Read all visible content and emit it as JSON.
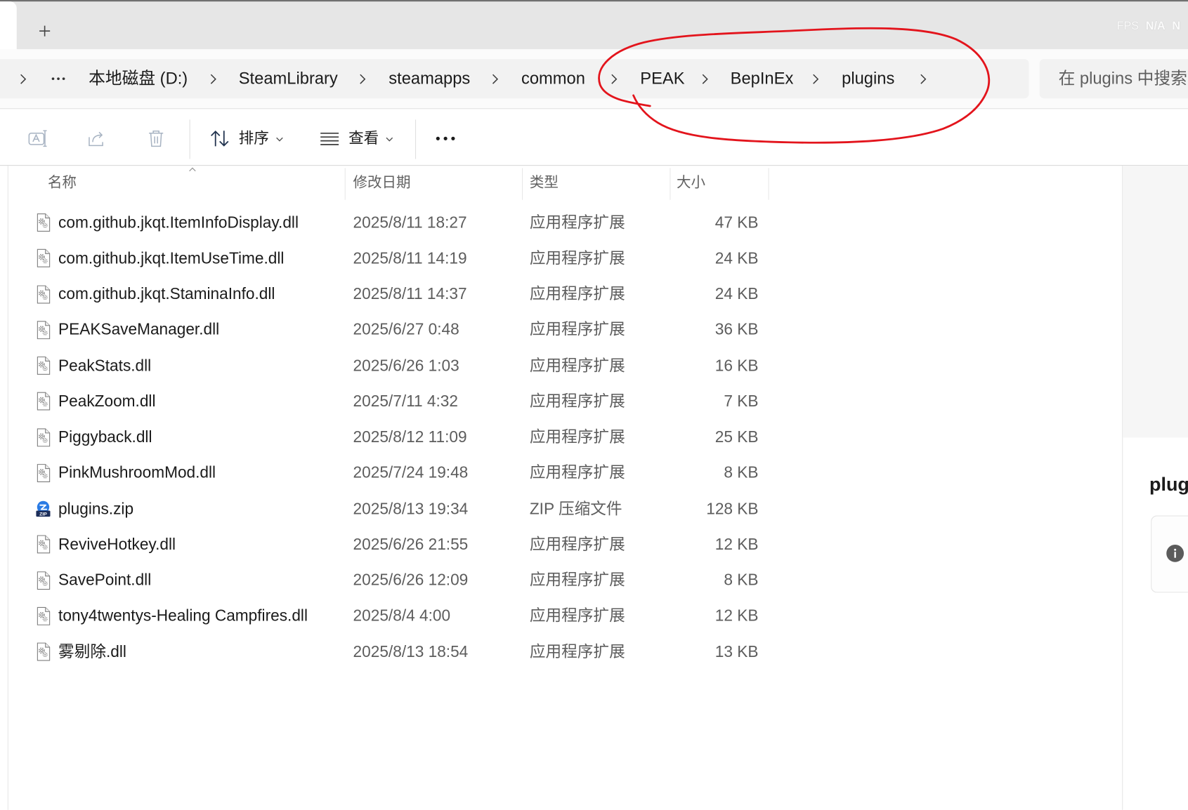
{
  "overlay": {
    "fps_label": "FPS",
    "fps_value": "N/A",
    "fps_extra": "N"
  },
  "breadcrumb": {
    "items": [
      {
        "label": "本地磁盘 (D:)"
      },
      {
        "label": "SteamLibrary"
      },
      {
        "label": "steamapps"
      },
      {
        "label": "common"
      },
      {
        "label": "PEAK"
      },
      {
        "label": "BepInEx"
      },
      {
        "label": "plugins"
      }
    ]
  },
  "search": {
    "placeholder": "在 plugins 中搜索"
  },
  "toolbar": {
    "icons": [
      "rename-icon",
      "share-icon",
      "delete-icon",
      "sort-icon",
      "view-icon",
      "more-icon"
    ],
    "sort_label": "排序",
    "view_label": "查看"
  },
  "columns": {
    "name": "名称",
    "modified": "修改日期",
    "type": "类型",
    "size": "大小",
    "sort_indicator_icon": "chevron-up-icon"
  },
  "files": [
    {
      "name": "com.github.jkqt.ItemInfoDisplay.dll",
      "modified": "2025/8/11 18:27",
      "type": "应用程序扩展",
      "size": "47 KB",
      "icon": "dll-file-icon"
    },
    {
      "name": "com.github.jkqt.ItemUseTime.dll",
      "modified": "2025/8/11 14:19",
      "type": "应用程序扩展",
      "size": "24 KB",
      "icon": "dll-file-icon"
    },
    {
      "name": "com.github.jkqt.StaminaInfo.dll",
      "modified": "2025/8/11 14:37",
      "type": "应用程序扩展",
      "size": "24 KB",
      "icon": "dll-file-icon"
    },
    {
      "name": "PEAKSaveManager.dll",
      "modified": "2025/6/27 0:48",
      "type": "应用程序扩展",
      "size": "36 KB",
      "icon": "dll-file-icon"
    },
    {
      "name": "PeakStats.dll",
      "modified": "2025/6/26 1:03",
      "type": "应用程序扩展",
      "size": "16 KB",
      "icon": "dll-file-icon"
    },
    {
      "name": "PeakZoom.dll",
      "modified": "2025/7/11 4:32",
      "type": "应用程序扩展",
      "size": "7 KB",
      "icon": "dll-file-icon"
    },
    {
      "name": "Piggyback.dll",
      "modified": "2025/8/12 11:09",
      "type": "应用程序扩展",
      "size": "25 KB",
      "icon": "dll-file-icon"
    },
    {
      "name": "PinkMushroomMod.dll",
      "modified": "2025/7/24 19:48",
      "type": "应用程序扩展",
      "size": "8 KB",
      "icon": "dll-file-icon"
    },
    {
      "name": "plugins.zip",
      "modified": "2025/8/13 19:34",
      "type": "ZIP 压缩文件",
      "size": "128 KB",
      "icon": "zip-file-icon",
      "icon_text": "ZIP"
    },
    {
      "name": "ReviveHotkey.dll",
      "modified": "2025/6/26 21:55",
      "type": "应用程序扩展",
      "size": "12 KB",
      "icon": "dll-file-icon"
    },
    {
      "name": "SavePoint.dll",
      "modified": "2025/6/26 12:09",
      "type": "应用程序扩展",
      "size": "8 KB",
      "icon": "dll-file-icon"
    },
    {
      "name": "tony4twentys-Healing Campfires.dll",
      "modified": "2025/8/4 4:00",
      "type": "应用程序扩展",
      "size": "12 KB",
      "icon": "dll-file-icon"
    },
    {
      "name": "雾剔除.dll",
      "modified": "2025/8/13 18:54",
      "type": "应用程序扩展",
      "size": "13 KB",
      "icon": "dll-file-icon"
    }
  ],
  "details_pane": {
    "title": "plug",
    "info_icon": "info-icon"
  },
  "colors": {
    "annotation": "#e3141c",
    "zip_icon_blue": "#2a7be4",
    "disabled_icon": "#a7b3c2"
  }
}
